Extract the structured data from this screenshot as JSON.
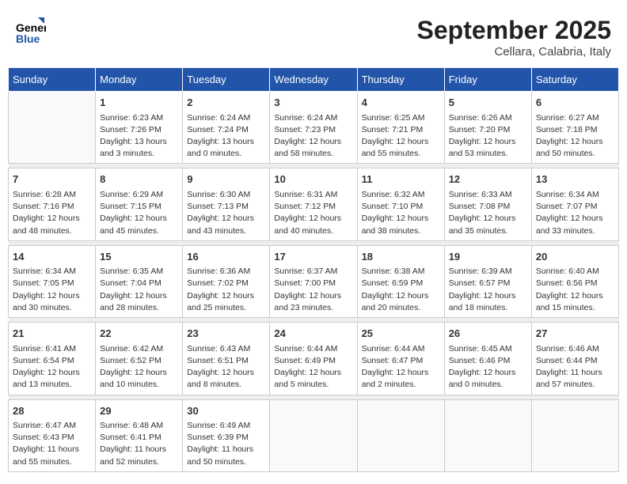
{
  "header": {
    "logo_line1": "General",
    "logo_line2": "Blue",
    "month": "September 2025",
    "location": "Cellara, Calabria, Italy"
  },
  "weekdays": [
    "Sunday",
    "Monday",
    "Tuesday",
    "Wednesday",
    "Thursday",
    "Friday",
    "Saturday"
  ],
  "weeks": [
    [
      {
        "day": "",
        "info": ""
      },
      {
        "day": "1",
        "info": "Sunrise: 6:23 AM\nSunset: 7:26 PM\nDaylight: 13 hours\nand 3 minutes."
      },
      {
        "day": "2",
        "info": "Sunrise: 6:24 AM\nSunset: 7:24 PM\nDaylight: 13 hours\nand 0 minutes."
      },
      {
        "day": "3",
        "info": "Sunrise: 6:24 AM\nSunset: 7:23 PM\nDaylight: 12 hours\nand 58 minutes."
      },
      {
        "day": "4",
        "info": "Sunrise: 6:25 AM\nSunset: 7:21 PM\nDaylight: 12 hours\nand 55 minutes."
      },
      {
        "day": "5",
        "info": "Sunrise: 6:26 AM\nSunset: 7:20 PM\nDaylight: 12 hours\nand 53 minutes."
      },
      {
        "day": "6",
        "info": "Sunrise: 6:27 AM\nSunset: 7:18 PM\nDaylight: 12 hours\nand 50 minutes."
      }
    ],
    [
      {
        "day": "7",
        "info": "Sunrise: 6:28 AM\nSunset: 7:16 PM\nDaylight: 12 hours\nand 48 minutes."
      },
      {
        "day": "8",
        "info": "Sunrise: 6:29 AM\nSunset: 7:15 PM\nDaylight: 12 hours\nand 45 minutes."
      },
      {
        "day": "9",
        "info": "Sunrise: 6:30 AM\nSunset: 7:13 PM\nDaylight: 12 hours\nand 43 minutes."
      },
      {
        "day": "10",
        "info": "Sunrise: 6:31 AM\nSunset: 7:12 PM\nDaylight: 12 hours\nand 40 minutes."
      },
      {
        "day": "11",
        "info": "Sunrise: 6:32 AM\nSunset: 7:10 PM\nDaylight: 12 hours\nand 38 minutes."
      },
      {
        "day": "12",
        "info": "Sunrise: 6:33 AM\nSunset: 7:08 PM\nDaylight: 12 hours\nand 35 minutes."
      },
      {
        "day": "13",
        "info": "Sunrise: 6:34 AM\nSunset: 7:07 PM\nDaylight: 12 hours\nand 33 minutes."
      }
    ],
    [
      {
        "day": "14",
        "info": "Sunrise: 6:34 AM\nSunset: 7:05 PM\nDaylight: 12 hours\nand 30 minutes."
      },
      {
        "day": "15",
        "info": "Sunrise: 6:35 AM\nSunset: 7:04 PM\nDaylight: 12 hours\nand 28 minutes."
      },
      {
        "day": "16",
        "info": "Sunrise: 6:36 AM\nSunset: 7:02 PM\nDaylight: 12 hours\nand 25 minutes."
      },
      {
        "day": "17",
        "info": "Sunrise: 6:37 AM\nSunset: 7:00 PM\nDaylight: 12 hours\nand 23 minutes."
      },
      {
        "day": "18",
        "info": "Sunrise: 6:38 AM\nSunset: 6:59 PM\nDaylight: 12 hours\nand 20 minutes."
      },
      {
        "day": "19",
        "info": "Sunrise: 6:39 AM\nSunset: 6:57 PM\nDaylight: 12 hours\nand 18 minutes."
      },
      {
        "day": "20",
        "info": "Sunrise: 6:40 AM\nSunset: 6:56 PM\nDaylight: 12 hours\nand 15 minutes."
      }
    ],
    [
      {
        "day": "21",
        "info": "Sunrise: 6:41 AM\nSunset: 6:54 PM\nDaylight: 12 hours\nand 13 minutes."
      },
      {
        "day": "22",
        "info": "Sunrise: 6:42 AM\nSunset: 6:52 PM\nDaylight: 12 hours\nand 10 minutes."
      },
      {
        "day": "23",
        "info": "Sunrise: 6:43 AM\nSunset: 6:51 PM\nDaylight: 12 hours\nand 8 minutes."
      },
      {
        "day": "24",
        "info": "Sunrise: 6:44 AM\nSunset: 6:49 PM\nDaylight: 12 hours\nand 5 minutes."
      },
      {
        "day": "25",
        "info": "Sunrise: 6:44 AM\nSunset: 6:47 PM\nDaylight: 12 hours\nand 2 minutes."
      },
      {
        "day": "26",
        "info": "Sunrise: 6:45 AM\nSunset: 6:46 PM\nDaylight: 12 hours\nand 0 minutes."
      },
      {
        "day": "27",
        "info": "Sunrise: 6:46 AM\nSunset: 6:44 PM\nDaylight: 11 hours\nand 57 minutes."
      }
    ],
    [
      {
        "day": "28",
        "info": "Sunrise: 6:47 AM\nSunset: 6:43 PM\nDaylight: 11 hours\nand 55 minutes."
      },
      {
        "day": "29",
        "info": "Sunrise: 6:48 AM\nSunset: 6:41 PM\nDaylight: 11 hours\nand 52 minutes."
      },
      {
        "day": "30",
        "info": "Sunrise: 6:49 AM\nSunset: 6:39 PM\nDaylight: 11 hours\nand 50 minutes."
      },
      {
        "day": "",
        "info": ""
      },
      {
        "day": "",
        "info": ""
      },
      {
        "day": "",
        "info": ""
      },
      {
        "day": "",
        "info": ""
      }
    ]
  ]
}
